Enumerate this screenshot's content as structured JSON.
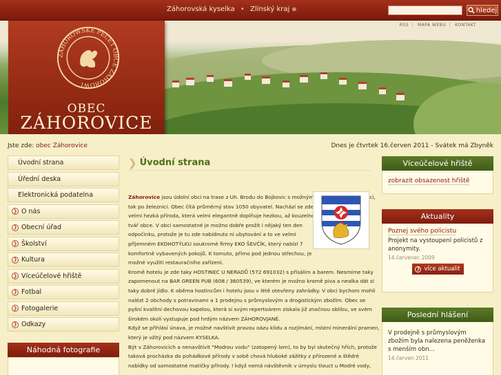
{
  "header": {
    "links": [
      "Záhorovská kyselka",
      "Zlínský kraj"
    ],
    "external_icon": "external-link-icon",
    "search": {
      "placeholder": "",
      "button_label": "hledej",
      "icon": "search-icon"
    },
    "util_links": [
      "RSS",
      "MAPA WEBU",
      "KONTAKT"
    ]
  },
  "logo": {
    "seal_text": "ZÁHOROWSKE PECET OBCE ZÁHOROWI",
    "obec_label": "OBEC",
    "town_name": "ZÁHOROVICE"
  },
  "breadcrumb": {
    "prefix": "Jste zde:",
    "items": [
      "obec Záhorovice"
    ]
  },
  "date_line": "Dnes je čtvrtek 16.červen 2011 - Svátek má Zbyněk",
  "nav": [
    {
      "label": "Úvodní strana",
      "arrow": false
    },
    {
      "label": "Úřední deska",
      "arrow": false
    },
    {
      "label": "Elektronická podatelna",
      "arrow": false
    },
    {
      "label": "O nás",
      "arrow": true
    },
    {
      "label": "Obecní úřad",
      "arrow": true
    },
    {
      "label": "Školství",
      "arrow": true
    },
    {
      "label": "Kultura",
      "arrow": true
    },
    {
      "label": "Víceúčelové hřiště",
      "arrow": true
    },
    {
      "label": "Fotbal",
      "arrow": true
    },
    {
      "label": "Fotogalerie",
      "arrow": true
    },
    {
      "label": "Odkazy",
      "arrow": true
    }
  ],
  "random_photo": {
    "title": "Náhodná fotografie"
  },
  "content": {
    "title": "Úvodní strana",
    "lead_bold": "Záhorovice",
    "lines": [
      " jsou údolní obcí na trase z Uh. Brodu do Bojkovic s možným příjezdem jak po silnici,",
      "tak po železnici. Obec čítá průměrný stav 1050 obyvatel. Nachází se zde",
      "velmi hezká příroda, která velmi elegantně doplňuje hezkou, až kouzelnou",
      "tvář obce. V obci samostatné je možno dobře prožít i nějaký ten den",
      "odpočinku, protože je tu zde nabídnuto ni ubytování a to ve velmi",
      "příjemném EKOHOTÝLKU soukromé firmy EKO ŠEVČÍK, který nabízí 7",
      "komfortně vybavených pokojů. K tomuto, přímo pod jednou střechou, je",
      "možné využití restauračního zařízení.",
      "Kromě hotelu je zde taky HOSTINEC U NERADŮ (572 691032) s přísálím a barem. Nesmíme taky",
      "zapomenout na BAR GREEN PUB (608 / 360539), ve kterém je možno kromě piva a nealka dát si",
      "taky dobré jídlo. K oběma hostincům i hotelu jsou v létě otevřeny zahrádky. V obci bychom mohli",
      "nalézt 2 obchody s potravinami a 1 prodejnu s průmyslovým a drogistickým zbožím. Obec se",
      "pyšní kvalitní dechovou kapelou, která si svým repertoárem získala již značnou oblibu, ve svém",
      "širokém okolí vystupuje pod hrdým názvem ZÁHOROVJANÉ.",
      "Když se přihlásí únava, je možné navštívit pravou oázu klidu a rozjímání, místní minerální pramen,",
      "který je vžitý pod názvem KYSELKA.",
      "Být v Záhorovicích a nenavštívit \"Modrou vodu\" (zatopený lom), to by byl skutečný hřích, protože",
      "taková procházka do pohádkové přírody v sobě chová hluboké zážitky z přírozené a štědré",
      "nabídky od samostatné matičky přírody. I když nemá návštěvník v úmyslu tlouct u Modré vody,"
    ]
  },
  "right": {
    "hriste": {
      "title": "Víceúčelové hřiště",
      "link": "zobrazit obsazenost hřiště"
    },
    "aktuality": {
      "title": "Aktuality",
      "news_title": "Poznej svého policistu",
      "news_desc": "Projekt na vystoupení policistů z anonymity.",
      "news_date": "14.červenec 2009",
      "more": "více aktualit"
    },
    "hlaseni": {
      "title": "Poslední hlášení",
      "desc": "V prodejně s průmyslovým zbožím byla nalezena peněženka s menším obn...",
      "date": "14.červen 2011"
    }
  },
  "colors": {
    "accent_red": "#8c2611",
    "title_green": "#4e6e18",
    "page_bg": "#f6efc8"
  }
}
